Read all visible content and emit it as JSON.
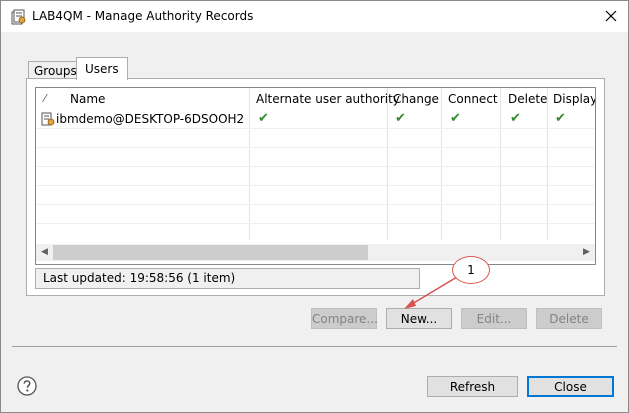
{
  "window": {
    "title": "LAB4QM - Manage Authority Records",
    "close_symbol": "✕"
  },
  "tabs": [
    {
      "label": "Groups",
      "active": false
    },
    {
      "label": "Users",
      "active": true
    }
  ],
  "table": {
    "sort_indicator": "⁄",
    "columns": [
      "Name",
      "Alternate user authority",
      "Change",
      "Connect",
      "Delete",
      "Display"
    ],
    "rows": [
      {
        "name": "ibmdemo@DESKTOP-6DSOOH2",
        "alternate_user_authority": true,
        "change": true,
        "connect": true,
        "delete": true,
        "display": true
      }
    ],
    "check_symbol": "✔"
  },
  "status": {
    "text": "Last updated: 19:58:56 (1 item)"
  },
  "buttons": {
    "compare": "Compare...",
    "new": "New...",
    "edit": "Edit...",
    "delete": "Delete",
    "refresh": "Refresh",
    "close": "Close"
  },
  "callout": {
    "label": "1",
    "color": "#d9534f"
  },
  "colors": {
    "check": "#2e8b2e",
    "accent": "#0078d7"
  }
}
